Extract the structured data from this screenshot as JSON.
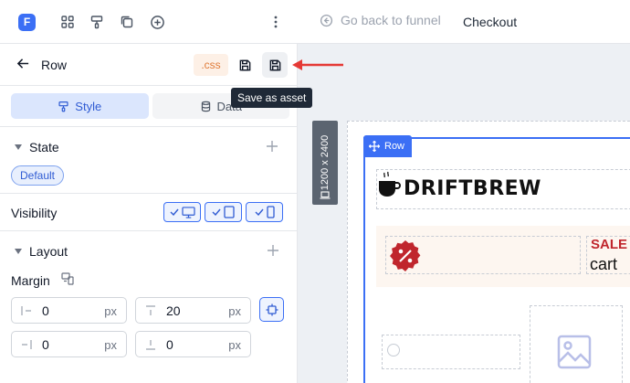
{
  "topbar": {
    "logo_letter": "F",
    "back_label": "Go back to funnel",
    "page_name": "Checkout",
    "icons": [
      "grid-icon",
      "paint-roller-icon",
      "copy-icon",
      "add-circle-icon",
      "more-vertical-icon"
    ]
  },
  "panel": {
    "title": "Row",
    "css_label": ".css",
    "tooltip": "Save as asset",
    "tabs": [
      {
        "label": "Style",
        "icon": "paint-roller-icon",
        "active": true
      },
      {
        "label": "Data",
        "icon": "database-icon",
        "active": false
      }
    ],
    "state": {
      "title": "State",
      "chip": "Default"
    },
    "visibility": {
      "label": "Visibility",
      "devices": [
        "desktop",
        "tablet",
        "mobile"
      ]
    },
    "layout": {
      "title": "Layout"
    },
    "margin": {
      "label": "Margin",
      "fields": [
        {
          "value": "0",
          "unit": "px",
          "side": "left"
        },
        {
          "value": "20",
          "unit": "px",
          "side": "top"
        },
        {
          "value": "0",
          "unit": "px",
          "side": "right"
        },
        {
          "value": "0",
          "unit": "px",
          "side": "bottom"
        }
      ]
    }
  },
  "canvas": {
    "size_label": "1200 x 2400",
    "row_tag": "Row",
    "brand": "DRIFTBREW",
    "sale_text": "SALE",
    "cart_text": "cart"
  },
  "colors": {
    "accent": "#3b6ff5",
    "css_chip": "#e07b39",
    "sale_red": "#c0262d",
    "annotation_arrow": "#e53935"
  }
}
